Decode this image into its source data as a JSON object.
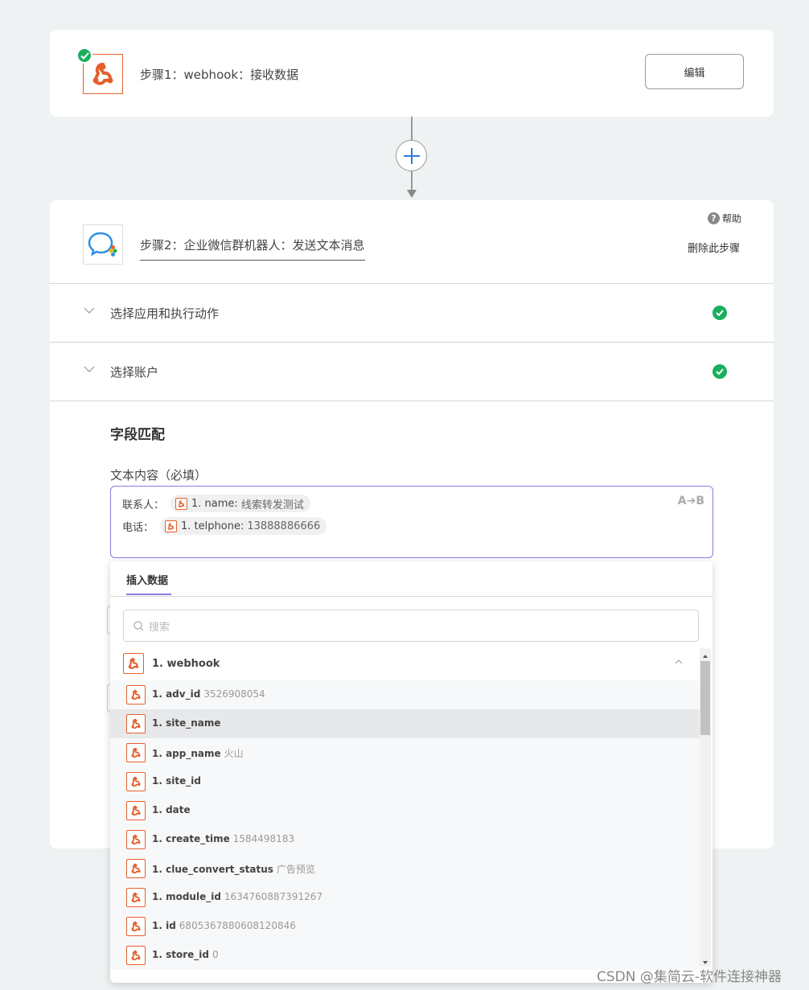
{
  "step1": {
    "title": "步骤1：webhook：接收数据",
    "edit_label": "编辑",
    "status": "completed"
  },
  "connector": {
    "add_icon": "plus-icon"
  },
  "step2": {
    "title": "步骤2：企业微信群机器人：发送文本消息",
    "help_label": "帮助",
    "help_icon": "question-icon",
    "delete_label": "删除此步骤",
    "sections": [
      {
        "label": "选择应用和执行动作",
        "status": "completed"
      },
      {
        "label": "选择账户",
        "status": "completed"
      }
    ],
    "field_mapping_title": "字段匹配",
    "text_field": {
      "label": "文本内容（必填）",
      "format_label": "A➔B",
      "lines": [
        {
          "prefix": "联系人：",
          "chip_key": "1. name:",
          "chip_value": "线索转发测试"
        },
        {
          "prefix": "电话：",
          "chip_key": "1. telphone:",
          "chip_value": "13888886666"
        }
      ]
    }
  },
  "insert_panel": {
    "tab_label": "插入数据",
    "search_placeholder": "搜索",
    "group_name": "1. webhook",
    "items": [
      {
        "key": "1. adv_id",
        "value": "3526908054"
      },
      {
        "key": "1. site_name",
        "value": ""
      },
      {
        "key": "1. app_name",
        "value": "火山"
      },
      {
        "key": "1. site_id",
        "value": ""
      },
      {
        "key": "1. date",
        "value": ""
      },
      {
        "key": "1. create_time",
        "value": "1584498183"
      },
      {
        "key": "1. clue_convert_status",
        "value": "广告预览"
      },
      {
        "key": "1. module_id",
        "value": "1634760887391267"
      },
      {
        "key": "1. id",
        "value": "6805367880608120846"
      },
      {
        "key": "1. store_id",
        "value": "0"
      }
    ],
    "highlighted_index": 1
  },
  "watermark": "CSDN @集简云-软件连接神器",
  "colors": {
    "accent": "#8a7ce0",
    "success": "#1aaf5d",
    "webhook_orange": "#e6602c",
    "wechat_blue": "#2f8fe4"
  }
}
